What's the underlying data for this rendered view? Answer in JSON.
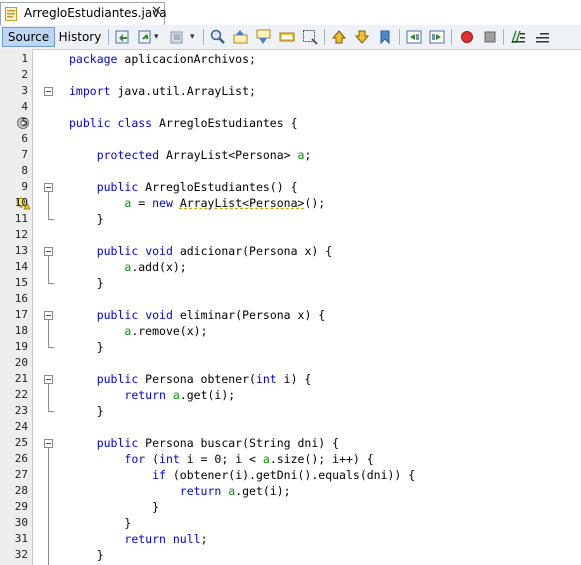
{
  "tab": {
    "title": "ArregloEstudiantes.java",
    "close": "✕"
  },
  "toolbar": {
    "source": "Source",
    "history": "History"
  },
  "code": [
    {
      "n": "1",
      "html": "<span class='kw'>package</span> aplicacionArchivos;"
    },
    {
      "n": "2",
      "html": ""
    },
    {
      "n": "3",
      "html": "<span class='kw'>import</span> java.util.ArrayList;"
    },
    {
      "n": "4",
      "html": ""
    },
    {
      "n": "5",
      "html": "<span class='kw'>public</span> <span class='kw'>class</span> ArregloEstudiantes {"
    },
    {
      "n": "6",
      "html": ""
    },
    {
      "n": "7",
      "html": "    <span class='kw'>protected</span> ArrayList&lt;Persona&gt; <span class='fld'>a</span>;"
    },
    {
      "n": "8",
      "html": ""
    },
    {
      "n": "9",
      "html": "    <span class='kw'>public</span> ArregloEstudiantes() {"
    },
    {
      "n": "10",
      "html": "        <span class='fld'>a</span> = <span class='kw'>new</span> <span style='text-decoration:underline dashed #c9a800'>ArrayList&lt;Persona&gt;</span>();"
    },
    {
      "n": "11",
      "html": "    }"
    },
    {
      "n": "12",
      "html": ""
    },
    {
      "n": "13",
      "html": "    <span class='kw'>public</span> <span class='kw'>void</span> adicionar(Persona x) {"
    },
    {
      "n": "14",
      "html": "        <span class='fld'>a</span>.add(x);"
    },
    {
      "n": "15",
      "html": "    }"
    },
    {
      "n": "16",
      "html": ""
    },
    {
      "n": "17",
      "html": "    <span class='kw'>public</span> <span class='kw'>void</span> eliminar(Persona x) {"
    },
    {
      "n": "18",
      "html": "        <span class='fld'>a</span>.remove(x);"
    },
    {
      "n": "19",
      "html": "    }"
    },
    {
      "n": "20",
      "html": ""
    },
    {
      "n": "21",
      "html": "    <span class='kw'>public</span> Persona obtener(<span class='kw'>int</span> i) {"
    },
    {
      "n": "22",
      "html": "        <span class='kw'>return</span> <span class='fld'>a</span>.get(i);"
    },
    {
      "n": "23",
      "html": "    }"
    },
    {
      "n": "24",
      "html": ""
    },
    {
      "n": "25",
      "html": "    <span class='kw'>public</span> Persona buscar(String dni) {"
    },
    {
      "n": "26",
      "html": "        <span class='kw'>for</span> (<span class='kw'>int</span> i = 0; i &lt; <span class='fld'>a</span>.size(); i++) {"
    },
    {
      "n": "27",
      "html": "            <span class='kw'>if</span> (obtener(i).getDni().equals(dni)) {"
    },
    {
      "n": "28",
      "html": "                <span class='kw'>return</span> <span class='fld'>a</span>.get(i);"
    },
    {
      "n": "29",
      "html": "            }"
    },
    {
      "n": "30",
      "html": "        }"
    },
    {
      "n": "31",
      "html": "        <span class='kw'>return</span> <span class='kw'>null</span>;"
    },
    {
      "n": "32",
      "html": "    }"
    }
  ]
}
